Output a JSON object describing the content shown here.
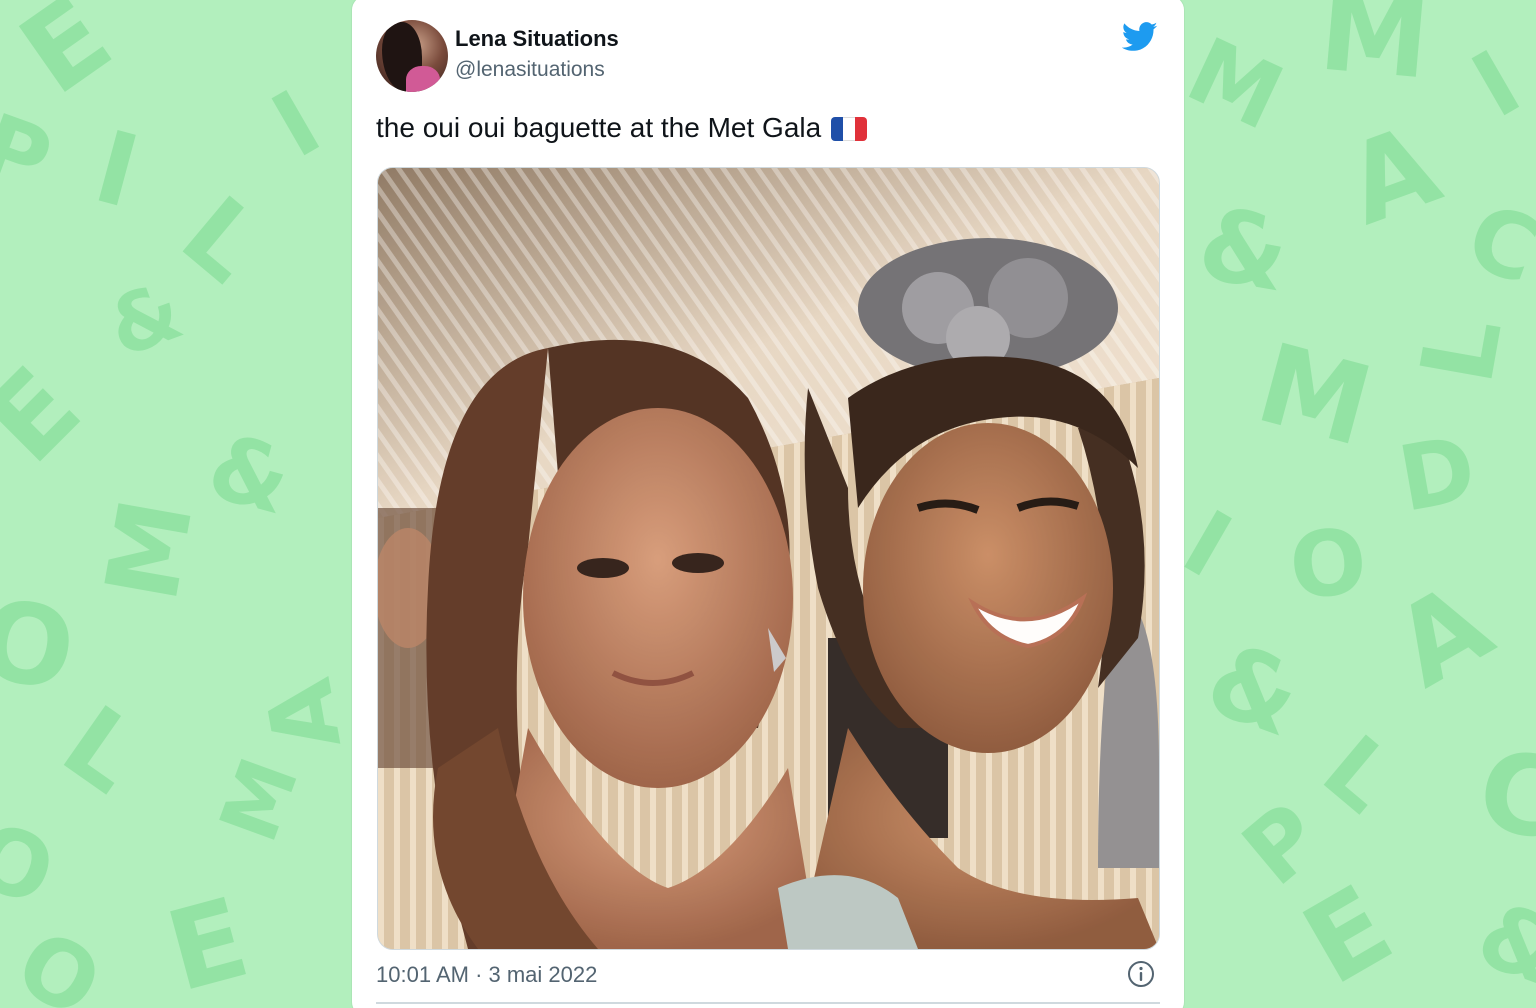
{
  "tweet": {
    "author_name": "Lena Situations",
    "author_handle": "@lenasituations",
    "text": "the oui oui baguette at the Met Gala",
    "emoji_flag": "french-flag-icon",
    "timestamp": "10:01 AM · 3 mai 2022",
    "brand_icon": "twitter-bird-icon",
    "info_icon": "info-icon"
  },
  "colors": {
    "background": "#b2efbd",
    "background_letters": "#93e3a4",
    "twitter_blue": "#1d9bf0",
    "text_primary": "#0f1419",
    "text_secondary": "#536471",
    "flag_blue": "#1f4fa8",
    "flag_white": "#ffffff",
    "flag_red": "#e0313a"
  }
}
